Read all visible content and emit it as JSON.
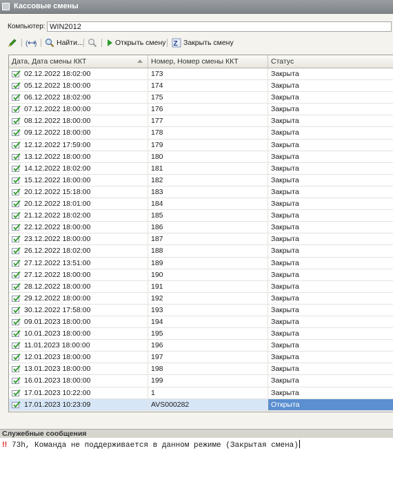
{
  "window": {
    "title": "Кассовые смены"
  },
  "computer": {
    "label": "Компьютер:",
    "value": "WIN2012"
  },
  "toolbar": {
    "find_label": "Найти...",
    "open_shift_label": "Открыть смену",
    "close_shift_label": "Закрыть смену",
    "icons": [
      "edit-icon",
      "link-icon",
      "search-icon",
      "filter-off-icon",
      "play-icon",
      "close-shift-icon"
    ]
  },
  "table": {
    "columns": [
      "Дата, Дата смены ККТ",
      "Номер, Номер смены ККТ",
      "Статус"
    ],
    "rows": [
      {
        "date": "02.12.2022 18:02:00",
        "number": "173",
        "status": "Закрыта"
      },
      {
        "date": "05.12.2022 18:00:00",
        "number": "174",
        "status": "Закрыта"
      },
      {
        "date": "06.12.2022 18:02:00",
        "number": "175",
        "status": "Закрыта"
      },
      {
        "date": "07.12.2022 18:00:00",
        "number": "176",
        "status": "Закрыта"
      },
      {
        "date": "08.12.2022 18:00:00",
        "number": "177",
        "status": "Закрыта"
      },
      {
        "date": "09.12.2022 18:00:00",
        "number": "178",
        "status": "Закрыта"
      },
      {
        "date": "12.12.2022 17:59:00",
        "number": "179",
        "status": "Закрыта"
      },
      {
        "date": "13.12.2022 18:00:00",
        "number": "180",
        "status": "Закрыта"
      },
      {
        "date": "14.12.2022 18:02:00",
        "number": "181",
        "status": "Закрыта"
      },
      {
        "date": "15.12.2022 18:00:00",
        "number": "182",
        "status": "Закрыта"
      },
      {
        "date": "20.12.2022 15:18:00",
        "number": "183",
        "status": "Закрыта"
      },
      {
        "date": "20.12.2022 18:01:00",
        "number": "184",
        "status": "Закрыта"
      },
      {
        "date": "21.12.2022 18:02:00",
        "number": "185",
        "status": "Закрыта"
      },
      {
        "date": "22.12.2022 18:00:00",
        "number": "186",
        "status": "Закрыта"
      },
      {
        "date": "23.12.2022 18:00:00",
        "number": "187",
        "status": "Закрыта"
      },
      {
        "date": "26.12.2022 18:02:00",
        "number": "188",
        "status": "Закрыта"
      },
      {
        "date": "27.12.2022 13:51:00",
        "number": "189",
        "status": "Закрыта"
      },
      {
        "date": "27.12.2022 18:00:00",
        "number": "190",
        "status": "Закрыта"
      },
      {
        "date": "28.12.2022 18:00:00",
        "number": "191",
        "status": "Закрыта"
      },
      {
        "date": "29.12.2022 18:00:00",
        "number": "192",
        "status": "Закрыта"
      },
      {
        "date": "30.12.2022 17:58:00",
        "number": "193",
        "status": "Закрыта"
      },
      {
        "date": "09.01.2023 18:00:00",
        "number": "194",
        "status": "Закрыта"
      },
      {
        "date": "10.01.2023 18:00:00",
        "number": "195",
        "status": "Закрыта"
      },
      {
        "date": "11.01.2023 18:00:00",
        "number": "196",
        "status": "Закрыта"
      },
      {
        "date": "12.01.2023 18:00:00",
        "number": "197",
        "status": "Закрыта"
      },
      {
        "date": "13.01.2023 18:00:00",
        "number": "198",
        "status": "Закрыта"
      },
      {
        "date": "16.01.2023 18:00:00",
        "number": "199",
        "status": "Закрыта"
      },
      {
        "date": "17.01.2023 10:22:00",
        "number": "1",
        "status": "Закрыта"
      },
      {
        "date": "17.01.2023 10:23:09",
        "number": "AVS000282",
        "status": "Открыта",
        "selected": true
      }
    ]
  },
  "messages": {
    "title": "Служебные сообщения",
    "items": [
      {
        "mark": "!!",
        "text": "73h, Команда не поддерживается в данном режиме (Закрытая смена)"
      }
    ]
  },
  "colors": {
    "selection": "#5b8fd0",
    "selection_light": "#d7e6f7",
    "titlebar": "#8a8e93"
  }
}
